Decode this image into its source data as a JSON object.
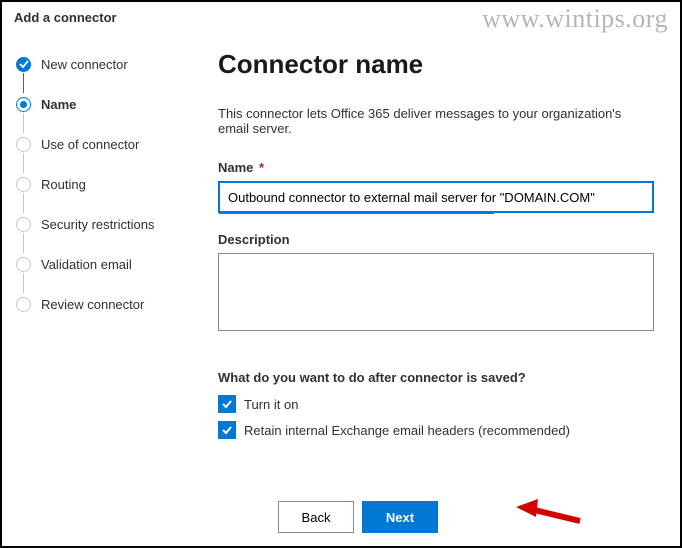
{
  "header": {
    "title": "Add a connector"
  },
  "watermark": "www.wintips.org",
  "sidebar": {
    "steps": [
      {
        "label": "New connector",
        "state": "done"
      },
      {
        "label": "Name",
        "state": "current"
      },
      {
        "label": "Use of connector",
        "state": "pending"
      },
      {
        "label": "Routing",
        "state": "pending"
      },
      {
        "label": "Security restrictions",
        "state": "pending"
      },
      {
        "label": "Validation email",
        "state": "pending"
      },
      {
        "label": "Review connector",
        "state": "pending"
      }
    ]
  },
  "main": {
    "title": "Connector name",
    "intro": "This connector lets Office 365 deliver messages to your organization's email server.",
    "name_label": "Name",
    "name_value": "Outbound connector to external mail server for \"DOMAIN.COM\"",
    "description_label": "Description",
    "description_value": "",
    "after_save_heading": "What do you want to do after connector is saved?",
    "checkboxes": [
      {
        "label": "Turn it on",
        "checked": true
      },
      {
        "label": "Retain internal Exchange email headers (recommended)",
        "checked": true
      }
    ]
  },
  "footer": {
    "back": "Back",
    "next": "Next"
  }
}
